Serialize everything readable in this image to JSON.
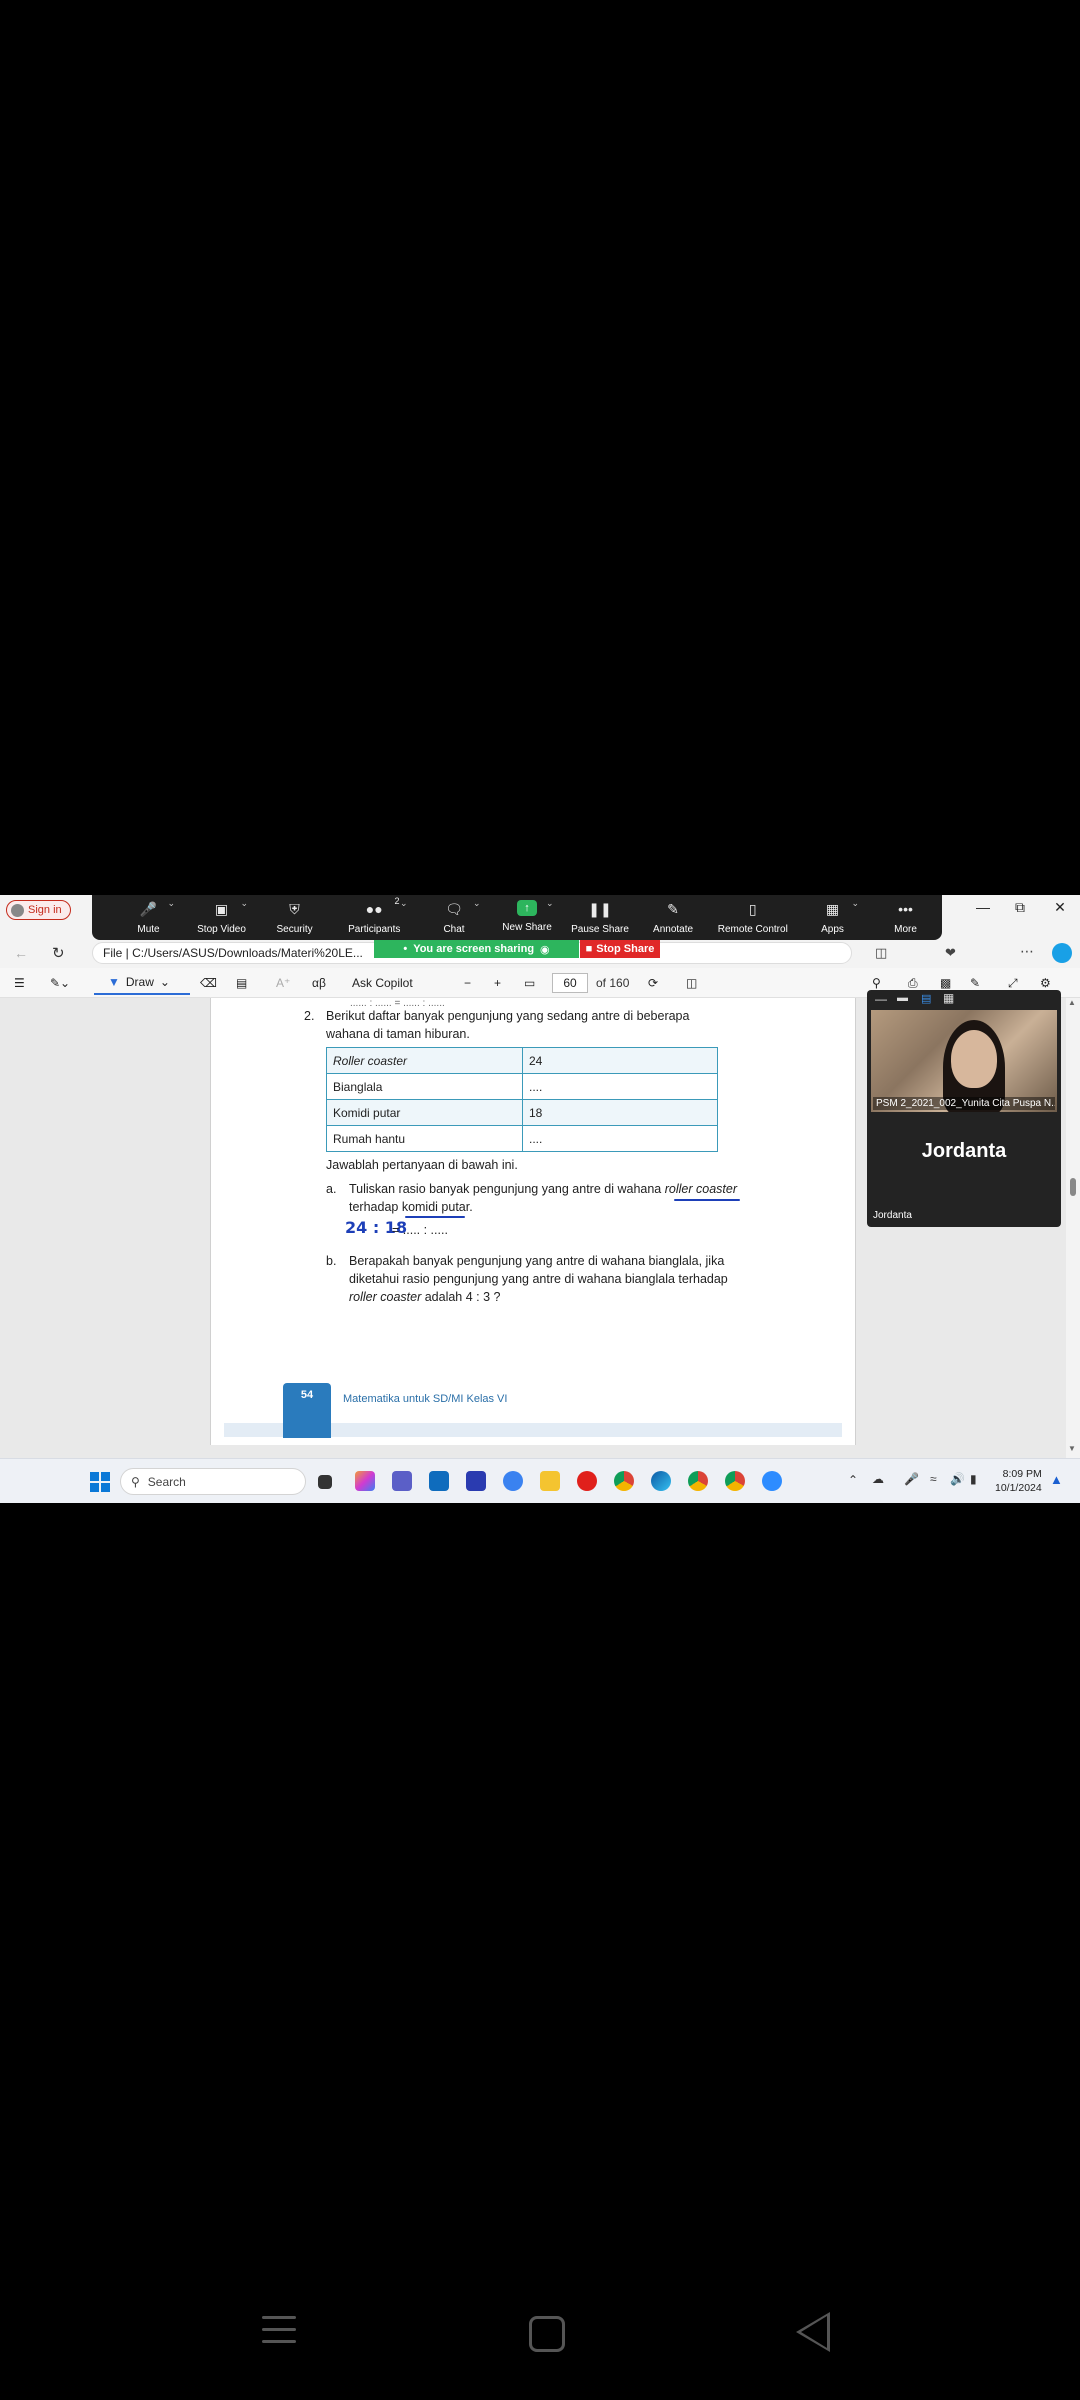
{
  "browser": {
    "signin_label": "Sign in",
    "address": "File  |  C:/Users/ASUS/Downloads/Materi%20LE..."
  },
  "zoom_toolbar": {
    "items": [
      {
        "label": "Mute",
        "icon": "microphone-icon"
      },
      {
        "label": "Stop Video",
        "icon": "video-camera-icon"
      },
      {
        "label": "Security",
        "icon": "shield-icon"
      },
      {
        "label": "Participants",
        "icon": "participants-icon",
        "badge": "2"
      },
      {
        "label": "Chat",
        "icon": "chat-icon"
      },
      {
        "label": "New Share",
        "icon": "share-icon"
      },
      {
        "label": "Pause Share",
        "icon": "pause-icon"
      },
      {
        "label": "Annotate",
        "icon": "pen-icon"
      },
      {
        "label": "Remote Control",
        "icon": "mouse-icon"
      },
      {
        "label": "Apps",
        "icon": "apps-icon"
      },
      {
        "label": "More",
        "icon": "more-icon"
      }
    ],
    "sharing_banner": "You are screen sharing",
    "stop_share": "Stop Share"
  },
  "pdf_toolbar": {
    "draw_label": "Draw",
    "ask_copilot": "Ask Copilot",
    "page_number": "60",
    "page_total": "of 160"
  },
  "document": {
    "top_cut_text": "...... : ...... = ...... : ......",
    "question_number": "2.",
    "question_line1": "Berikut daftar banyak pengunjung yang sedang antre di beberapa",
    "question_line2": "wahana di taman hiburan.",
    "table": [
      {
        "ride": "Roller coaster",
        "count": "24"
      },
      {
        "ride": "Bianglala",
        "count": "...."
      },
      {
        "ride": "Komidi putar",
        "count": "18"
      },
      {
        "ride": "Rumah hantu",
        "count": "...."
      }
    ],
    "instruction": "Jawablah pertanyaan di bawah ini.",
    "part_a_label": "a.",
    "part_a_line1_pre": "Tuliskan rasio banyak pengunjung yang antre di wahana ",
    "part_a_line1_italic": "roller coaster",
    "part_a_line2": "terhadap komidi putar.",
    "handwriting": "24 : 18",
    "part_a_answer": "= ..... : .....",
    "part_b_label": "b.",
    "part_b_line1": "Berapakah banyak pengunjung yang antre di wahana bianglala, jika",
    "part_b_line2": "diketahui rasio pengunjung yang antre di wahana bianglala terhadap",
    "part_b_line3_italic": "roller coaster",
    "part_b_line3_rest": " adalah 4 : 3 ?",
    "footer_page": "54",
    "footer_text": "Matematika untuk SD/MI Kelas VI"
  },
  "video_panel": {
    "participant_caption": "PSM 2_2021_002_Yunita Cita Puspa N...",
    "big_name": "Jordanta",
    "small_name": "Jordanta"
  },
  "taskbar": {
    "search_placeholder": "Search",
    "time": "8:09 PM",
    "date": "10/1/2024"
  },
  "colors": {
    "zoom_green": "#2db55d",
    "stop_red": "#e02828",
    "ink_blue": "#1d3fb8",
    "table_border": "#3b9ab9",
    "footer_blue": "#2a7bbd"
  }
}
